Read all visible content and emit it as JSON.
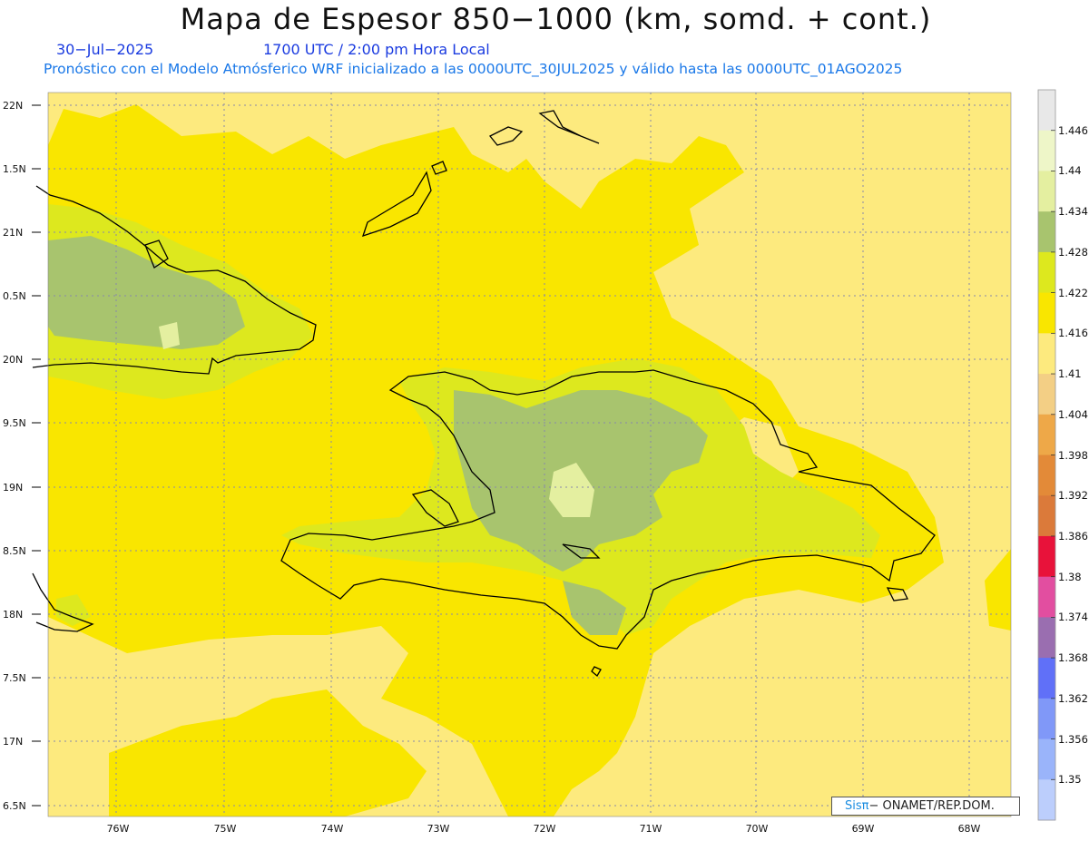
{
  "header": {
    "title": "Mapa de Espesor 850−1000 (km, somd. + cont.)",
    "date": "30−Jul−2025",
    "time": "1700 UTC / 2:00 pm Hora Local",
    "forecast": "Pronóstico con el Modelo Atmósferico WRF inicializado a las 0000UTC_30JUL2025 y válido hasta las  0000UTC_01AGO2025"
  },
  "axes": {
    "lat_labels": [
      "22N",
      "1.5N",
      "21N",
      "0.5N",
      "20N",
      "9.5N",
      "19N",
      "8.5N",
      "18N",
      "7.5N",
      "17N",
      "6.5N"
    ],
    "lon_labels": [
      "76W",
      "75W",
      "74W",
      "73W",
      "72W",
      "71W",
      "70W",
      "69W",
      "68W"
    ]
  },
  "legend": {
    "labels": [
      "1.446",
      "1.44",
      "1.434",
      "1.428",
      "1.422",
      "1.416",
      "1.41",
      "1.404",
      "1.398",
      "1.392",
      "1.386",
      "1.38",
      "1.374",
      "1.368",
      "1.362",
      "1.356",
      "1.35"
    ],
    "colors": [
      "#e8e8e8",
      "#eef6c8",
      "#e4efa0",
      "#a8c46e",
      "#dde81e",
      "#f9e600",
      "#fdea7e",
      "#f3cf85",
      "#eea848",
      "#e38a38",
      "#db7a3a",
      "#e8123a",
      "#e24ea0",
      "#9a6eb0",
      "#6070f8",
      "#8098f8",
      "#9ab4fa",
      "#bccefc"
    ]
  },
  "credit": {
    "sis": "Sisπ",
    "text": "− ONAMET/REP.DOM."
  },
  "colors": {
    "pale": "#fdea7e",
    "yellow": "#f9e600",
    "lime": "#dde81e",
    "green": "#a8c46e",
    "lightgreen": "#e4efa0"
  }
}
